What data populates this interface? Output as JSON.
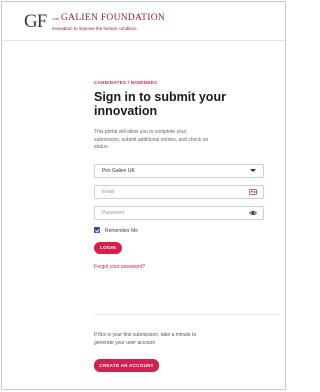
{
  "header": {
    "logo_monogram": "GF",
    "logo_the": "THE",
    "logo_name": "GALIEN FOUNDATION",
    "tagline": "innovation to improve the human condition"
  },
  "login": {
    "eyebrow": "CANDIDATES / NOMINEES",
    "title": "Sign in to submit your innovation",
    "intro": "This portal will allow you to complete your submission, submit additional entries, and check on status.",
    "select_value": "Prix Galien UK",
    "email_placeholder": "Email",
    "password_placeholder": "Password",
    "remember_label": "Remember Me",
    "remember_checked": true,
    "login_button": "LOGIN",
    "forgot_link": "Forgot your password?"
  },
  "signup": {
    "text": "If this is your first submission, take a minute to generate your user account",
    "button": "CREATE AN ACCOUNT"
  },
  "colors": {
    "accent": "#d2214f",
    "brand": "#8f1e35",
    "checkbox": "#2e4aa6"
  },
  "icons": {
    "email_field": "contact-card-icon",
    "password_field": "eye-icon",
    "select": "chevron-down-icon"
  }
}
